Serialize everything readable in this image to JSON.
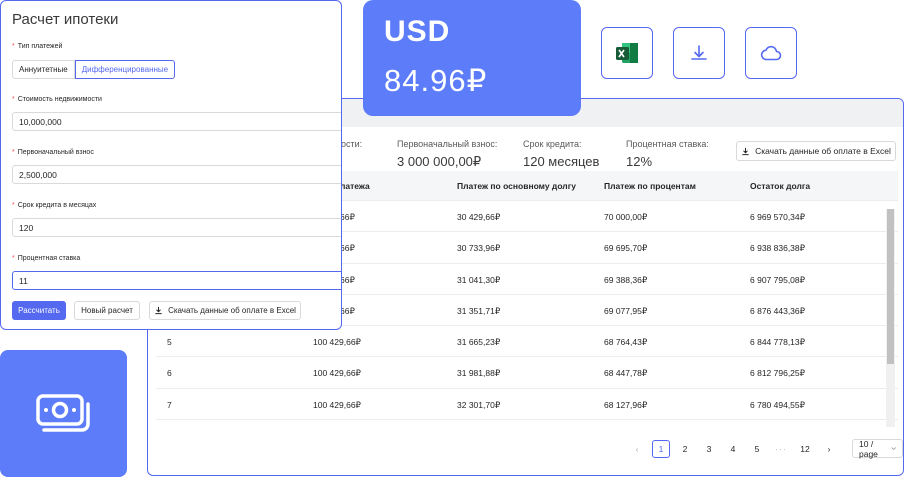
{
  "usd": {
    "currency": "USD",
    "rate": "84.96₽"
  },
  "icons": {
    "excel": "excel-icon",
    "download": "download-icon",
    "cloud": "cloud-icon",
    "money": "money-icon"
  },
  "colors": {
    "accent": "#5468f0",
    "card": "#5c7cfa",
    "required": "#ff4d4f"
  },
  "form": {
    "title": "Расчет ипотеки",
    "payment_type_label": "Тип платежей",
    "payment_types": [
      "Аннуитетные",
      "Дифференцированные"
    ],
    "payment_type_selected": "Дифференцированные",
    "property_cost_label": "Стоимость недвижимости",
    "property_cost": "10,000,000",
    "down_payment_label": "Первоначальный взнос",
    "down_payment": "2,500,000",
    "term_label": "Срок кредита в месяцах",
    "term": "120",
    "rate_label": "Процентная ставка",
    "rate": "11",
    "calc_button": "Рассчитать",
    "new_button": "Новый расчет",
    "download_button": "Скачать данные об оплате в Excel"
  },
  "results": {
    "summary": [
      {
        "label": "ости:",
        "value": ""
      },
      {
        "label": "Первоначальный взнос:",
        "value": "3 000 000,00₽"
      },
      {
        "label": "Срок кредита:",
        "value": "120 месяцев"
      },
      {
        "label": "Процентная ставка:",
        "value": "12%"
      }
    ],
    "download_button": "Скачать данные об оплате в Excel",
    "columns": [
      "",
      "латежа",
      "Платеж по основному долгу",
      "Платеж по процентам",
      "Остаток долга"
    ],
    "rows": [
      [
        "",
        "66₽",
        "30 429,66₽",
        "70 000,00₽",
        "6 969 570,34₽"
      ],
      [
        "",
        "66₽",
        "30 733,96₽",
        "69 695,70₽",
        "6 938 836,38₽"
      ],
      [
        "",
        "66₽",
        "31 041,30₽",
        "69 388,36₽",
        "6 907 795,08₽"
      ],
      [
        "",
        "66₽",
        "31 351,71₽",
        "69 077,95₽",
        "6 876 443,36₽"
      ],
      [
        "5",
        "100 429,66₽",
        "31 665,23₽",
        "68 764,43₽",
        "6 844 778,13₽"
      ],
      [
        "6",
        "100 429,66₽",
        "31 981,88₽",
        "68 447,78₽",
        "6 812 796,25₽"
      ],
      [
        "7",
        "100 429,66₽",
        "32 301,70₽",
        "68 127,96₽",
        "6 780 494,55₽"
      ]
    ],
    "pagination": {
      "prev": "‹",
      "pages": [
        "1",
        "2",
        "3",
        "4",
        "5",
        "···",
        "12"
      ],
      "current": "1",
      "next": "›",
      "page_size": "10 / page"
    }
  }
}
